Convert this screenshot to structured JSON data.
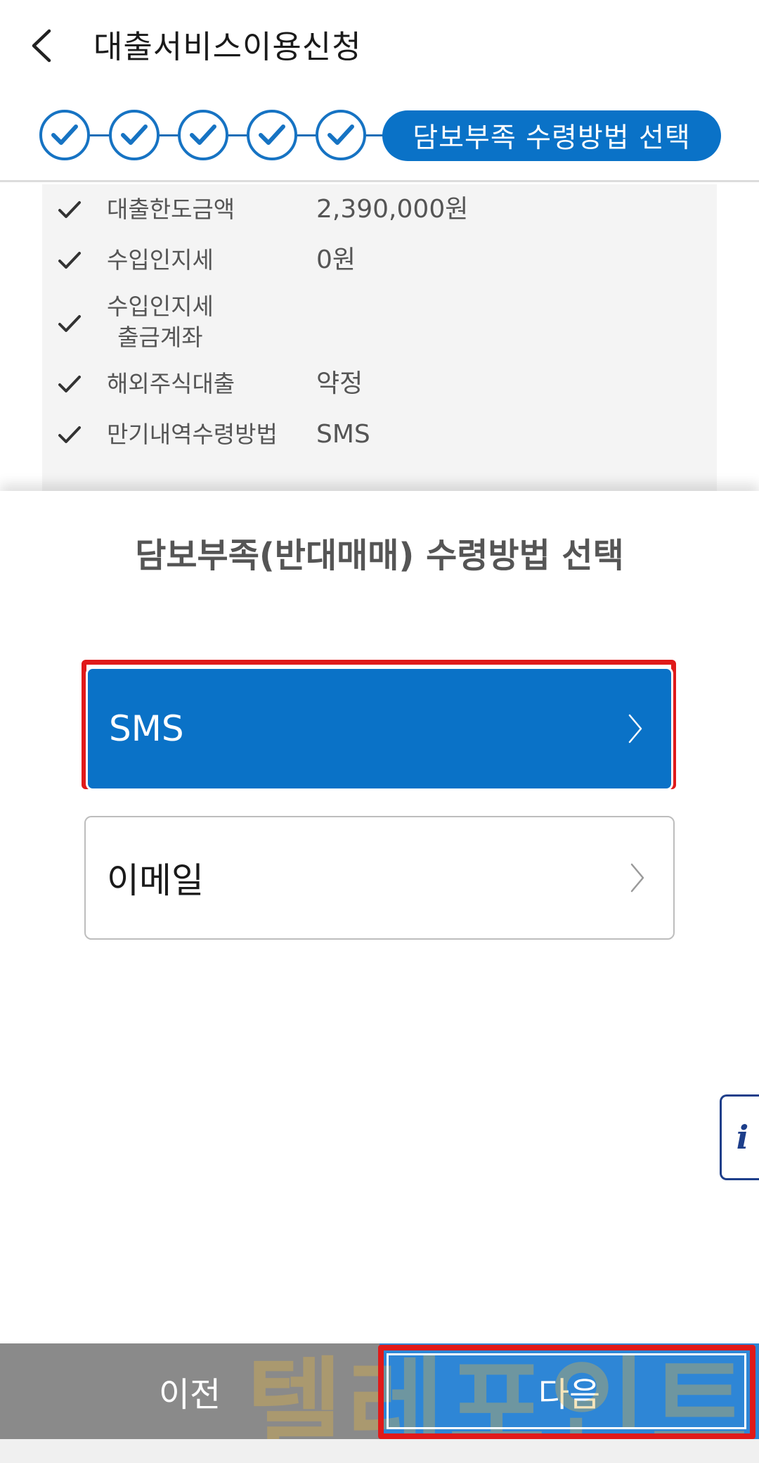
{
  "header": {
    "title": "대출서비스이용신청",
    "back_icon": "chevron-left-icon"
  },
  "stepper": {
    "completed_count": 5,
    "current_label": "담보부족 수령방법 선택"
  },
  "summary": {
    "rows": [
      {
        "label": "대출한도금액",
        "value": "2,390,000원"
      },
      {
        "label": "수입인지세",
        "value": "0원"
      },
      {
        "label": "수입인지세\n출금계좌",
        "value": ""
      },
      {
        "label": "해외주식대출",
        "value": "약정"
      },
      {
        "label": "만기내역수령방법",
        "value": "SMS"
      }
    ]
  },
  "sheet": {
    "title": "담보부족(반대매매) 수령방법 선택",
    "options": [
      {
        "label": "SMS",
        "selected": true
      },
      {
        "label": "이메일",
        "selected": false
      }
    ]
  },
  "info_tab": {
    "label": "i"
  },
  "footer": {
    "prev_label": "이전",
    "next_label": "다음"
  },
  "watermark": {
    "text": "텔레포인트"
  },
  "colors": {
    "primary": "#0a72c7",
    "next_button": "#2e86d6",
    "prev_button": "#8a8a8a",
    "highlight": "#e01a1a"
  }
}
